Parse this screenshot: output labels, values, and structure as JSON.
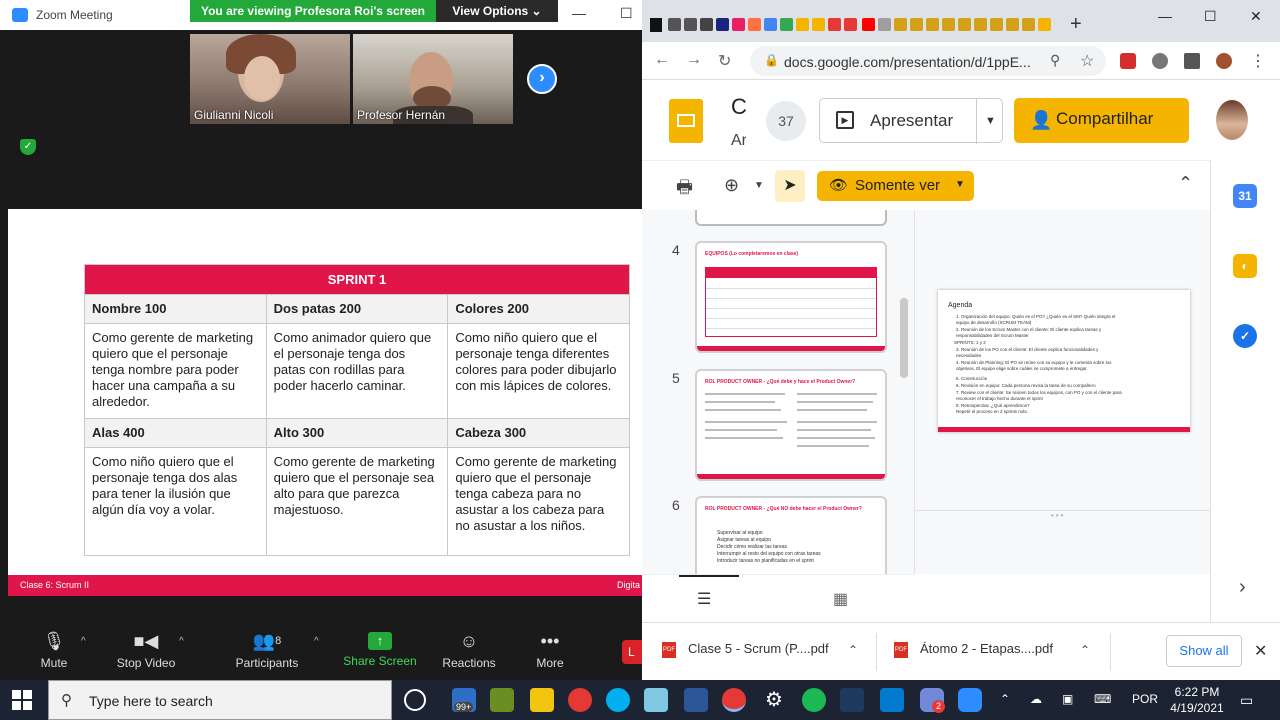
{
  "zoom": {
    "window_title": "Zoom Meeting",
    "banner_text": "You are viewing Profesora Roi's screen",
    "view_options": "View Options",
    "participants": [
      {
        "name": "Giulianni Nicoli"
      },
      {
        "name": "Profesor Hernán"
      }
    ],
    "slide": {
      "table_title": "SPRINT 1",
      "headers_row1": [
        "Nombre 100",
        "Dos patas 200",
        "Colores 200"
      ],
      "cells_row1": [
        "Como gerente de marketing quiero que el personaje tenga nombre para poder hacer una campaña a su alrededor.",
        "Como animador quiero que el personaje tenga dos patas con rodillas para poder hacerlo caminar.",
        "Como niño quiero que el personaje tenga diferentes colores para poder dibujarlo con mis lápices de colores."
      ],
      "headers_row2": [
        "Alas 400",
        "Alto 300",
        "Cabeza 300"
      ],
      "cells_row2": [
        "Como niño quiero que el personaje tenga dos alas para tener la ilusión que algún día voy a volar.",
        "Como gerente de marketing quiero que el personaje sea alto para que parezca majestuoso.",
        "Como gerente de marketing quiero que el personaje tenga cabeza para no asustar a los cabeza para no asustar a los niños."
      ],
      "footer_left": "Clase 6: Scrum II",
      "footer_right": "Digita"
    },
    "toolbar": {
      "mute": "Mute",
      "stop_video": "Stop Video",
      "participants": "Participants",
      "participants_count": "8",
      "share_screen": "Share Screen",
      "reactions": "Reactions",
      "more": "More",
      "end": "L"
    }
  },
  "chrome": {
    "url": "docs.google.com/presentation/d/1ppE...",
    "new_tab": "+",
    "doc_title_fragment": "C",
    "doc_subtitle_fragment": "Ar",
    "viewer_count": "37",
    "present_label": "Apresentar",
    "share_label": "Compartilhar",
    "view_only_label": "Somente ver",
    "filmstrip": [
      {
        "num": "4",
        "title": "EQUIPOS (Lo completaremos en clase)"
      },
      {
        "num": "5",
        "title": "ROL PRODUCT OWNER - ¿Qué debe y hace el Product Owner?"
      },
      {
        "num": "6",
        "title": "ROL PRODUCT OWNER - ¿Qué NO debe hacer el Product Owner?",
        "bullets": [
          "Supervisar al equipo",
          "Asignar tareas al equipo",
          "Decidir cómo realizar las tareas",
          "Interrumpir al resto del equipo con otras tareas",
          "Introducir tareas no planificadas en el sprint"
        ]
      }
    ],
    "canvas_slide": {
      "heading": "Agenda",
      "items": [
        "1. Organización del equipo: Quién es el PO? ¿Quién es el SM? Quién integra el",
        "   equipo de desarrollo (SCRUM TEAM)",
        "2. Reunión de los Scrum Master con el cliente: El cliente explica tareas y",
        "   responsabilidades del Scrum Master",
        "SPRINTS: 1 y 2",
        "3. Reunión de los PO con el cliente: El cliente explica funcionalidades y",
        "   necesidades",
        "4. Reunión de Planning: El PO se reúne con su equipo y le comenta sobre los",
        "   objetivos. El equipo elige sobre cuáles se compromete a entregar.",
        "5. Construcción",
        "6. Revisión en equipo: Cada persona revisa la tarea de su compañero",
        "7. Review con el cliente: Se reúnen todos los equipos, con PO y con el cliente para",
        "   reconocer el trabajo hecho durante el sprint",
        "8. Retrospectiva: ¿Qué aprendimos?",
        "   Repetir el proceso en 2 sprints más."
      ]
    },
    "downloads": [
      {
        "name": "Clase 5 - Scrum (P....pdf"
      },
      {
        "name": "Átomo 2 - Etapas....pdf"
      }
    ],
    "show_all": "Show all"
  },
  "taskbar": {
    "search_placeholder": "Type here to search",
    "language": "POR",
    "time": "6:22 PM",
    "date": "4/19/2021",
    "badge_count": "99+",
    "discord_badge": "2"
  }
}
